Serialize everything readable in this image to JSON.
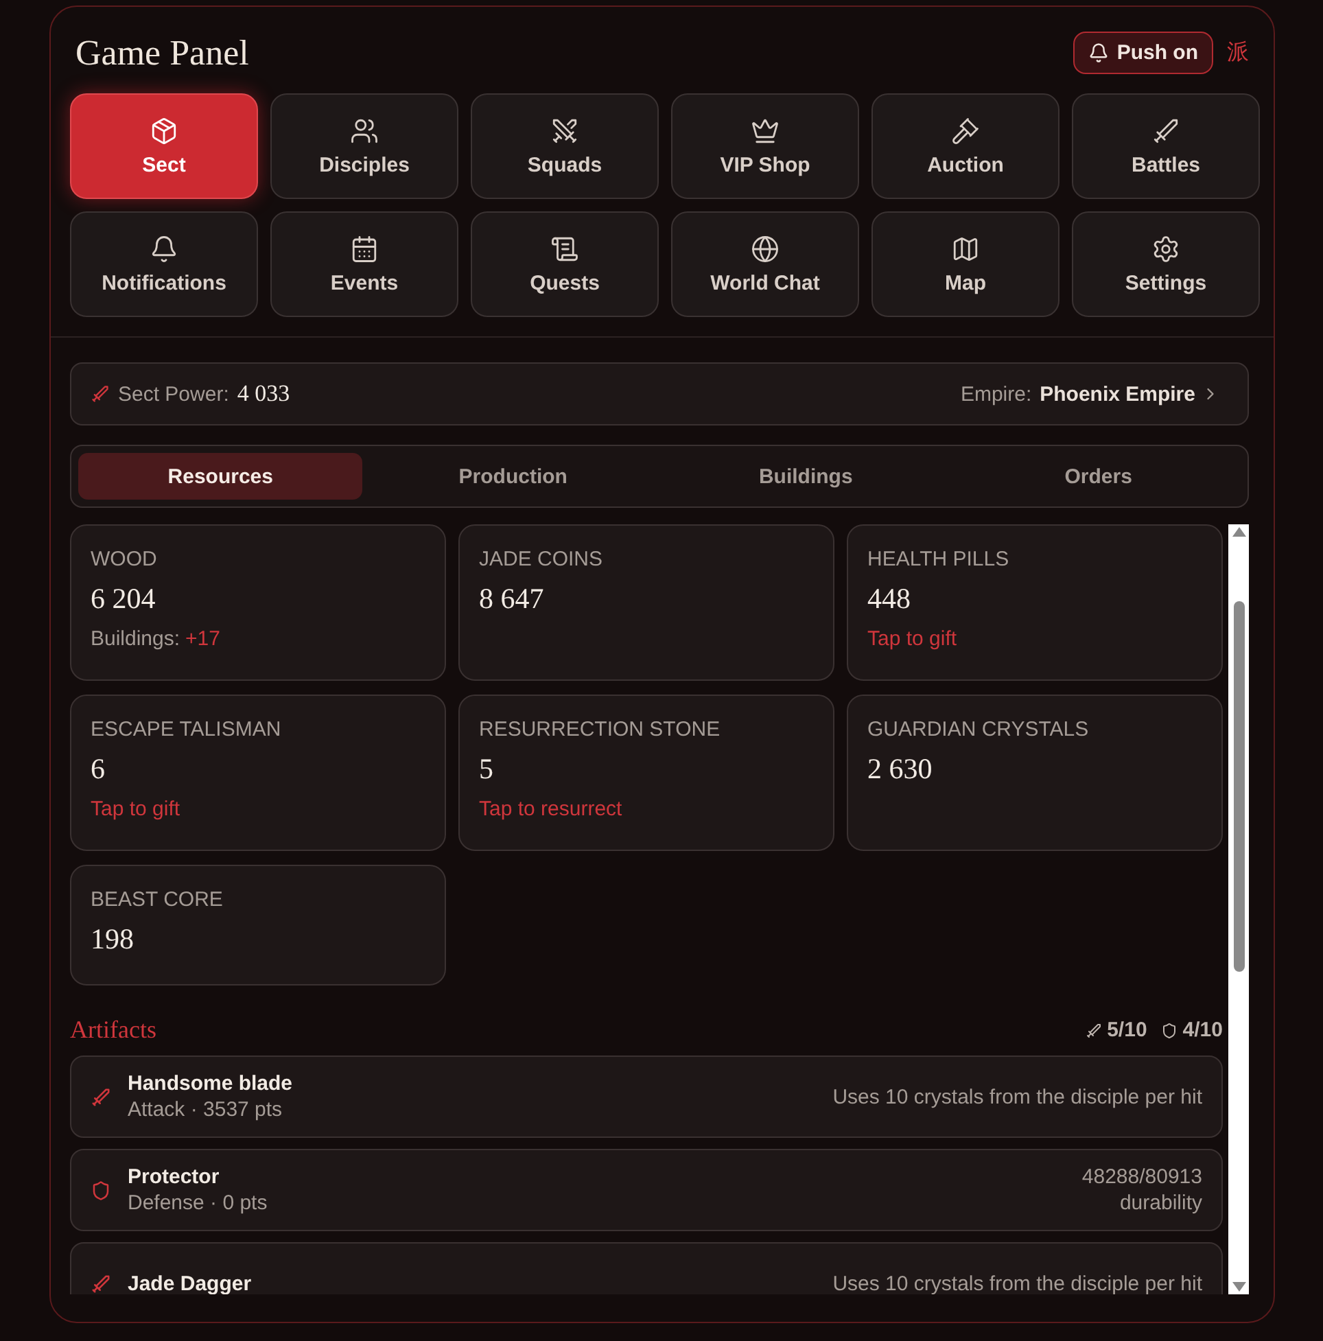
{
  "header": {
    "title": "Game Panel",
    "push": {
      "label": "Push on",
      "on": true
    },
    "glyph": "派"
  },
  "nav": [
    {
      "label": "Sect",
      "selected": true
    },
    {
      "label": "Disciples",
      "selected": false
    },
    {
      "label": "Squads",
      "selected": false
    },
    {
      "label": "VIP Shop",
      "selected": false
    },
    {
      "label": "Auction",
      "selected": false
    },
    {
      "label": "Battles",
      "selected": false
    },
    {
      "label": "Notifications",
      "selected": false
    },
    {
      "label": "Events",
      "selected": false
    },
    {
      "label": "Quests",
      "selected": false
    },
    {
      "label": "World Chat",
      "selected": false
    },
    {
      "label": "Map",
      "selected": false
    },
    {
      "label": "Settings",
      "selected": false
    }
  ],
  "power_bar": {
    "label": "Sect Power:",
    "value": "4 033",
    "empire_label": "Empire:",
    "empire": "Phoenix Empire"
  },
  "tabs": [
    {
      "label": "Resources",
      "selected": true
    },
    {
      "label": "Production",
      "selected": false
    },
    {
      "label": "Buildings",
      "selected": false
    },
    {
      "label": "Orders",
      "selected": false
    }
  ],
  "resources": [
    {
      "label": "WOOD",
      "value": "6 204",
      "note": {
        "kind": "stat",
        "label": "Buildings:",
        "value": "+17"
      }
    },
    {
      "label": "JADE COINS",
      "value": "8 647"
    },
    {
      "label": "HEALTH PILLS",
      "value": "448",
      "note": {
        "kind": "action",
        "label": "Tap to gift"
      }
    },
    {
      "label": "ESCAPE TALISMAN",
      "value": "6",
      "note": {
        "kind": "action",
        "label": "Tap to gift"
      }
    },
    {
      "label": "RESURRECTION STONE",
      "value": "5",
      "note": {
        "kind": "action",
        "label": "Tap to resurrect"
      }
    },
    {
      "label": "GUARDIAN CRYSTALS",
      "value": "2 630"
    },
    {
      "label": "BEAST CORE",
      "value": "198"
    }
  ],
  "artifacts": {
    "title": "Artifacts",
    "counts": [
      {
        "kind": "attack",
        "text": "5/10"
      },
      {
        "kind": "defense",
        "text": "4/10"
      }
    ],
    "items": [
      {
        "kind": "attack",
        "name": "Handsome blade",
        "detail": "Attack · 3537 pts",
        "info": [
          "Uses 10 crystals from the disciple per hit"
        ]
      },
      {
        "kind": "defense",
        "name": "Protector",
        "detail": "Defense · 0 pts",
        "info": [
          "48288/80913",
          "durability"
        ]
      },
      {
        "kind": "attack",
        "name": "Jade Dagger",
        "info": [
          "Uses 10 crystals from the disciple per hit"
        ]
      }
    ]
  }
}
